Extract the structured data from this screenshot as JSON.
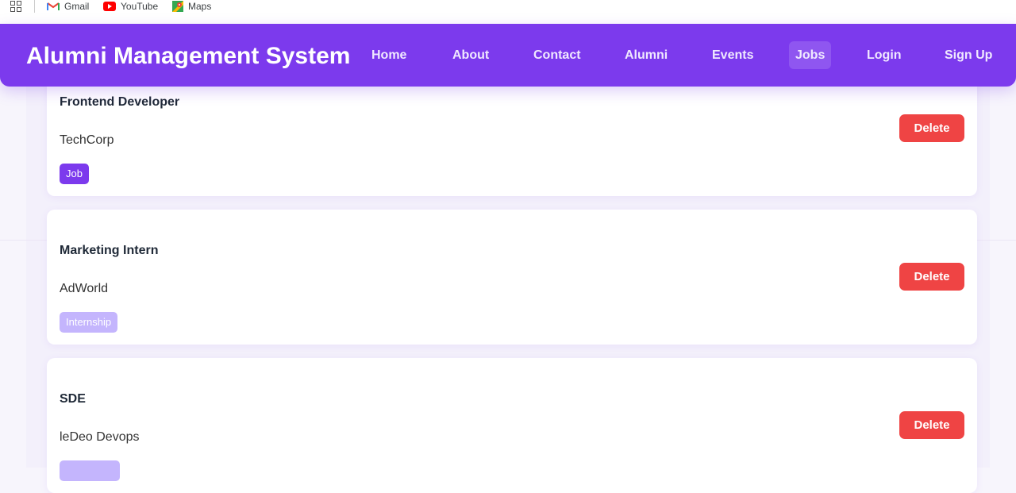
{
  "bookmarks": {
    "items": [
      {
        "label": "Gmail",
        "icon": "gmail-icon"
      },
      {
        "label": "YouTube",
        "icon": "youtube-icon"
      },
      {
        "label": "Maps",
        "icon": "maps-icon"
      }
    ]
  },
  "navbar": {
    "brand": "Alumni Management System",
    "links": [
      "Home",
      "About",
      "Contact",
      "Alumni",
      "Events",
      "Jobs",
      "Login",
      "Sign Up"
    ],
    "active": "Jobs",
    "color": "#7c3aed"
  },
  "jobs": [
    {
      "title": "Frontend Developer",
      "company": "TechCorp",
      "type": "Job",
      "action": "Delete"
    },
    {
      "title": "Marketing Intern",
      "company": "AdWorld",
      "type": "Internship",
      "action": "Delete"
    },
    {
      "title": "SDE",
      "company": "leDeo Devops",
      "type": "",
      "action": "Delete"
    }
  ],
  "colors": {
    "accent": "#7c3aed",
    "tag_job": "#7c3aed",
    "tag_internship": "#c4b5fd",
    "delete": "#ef4444"
  }
}
